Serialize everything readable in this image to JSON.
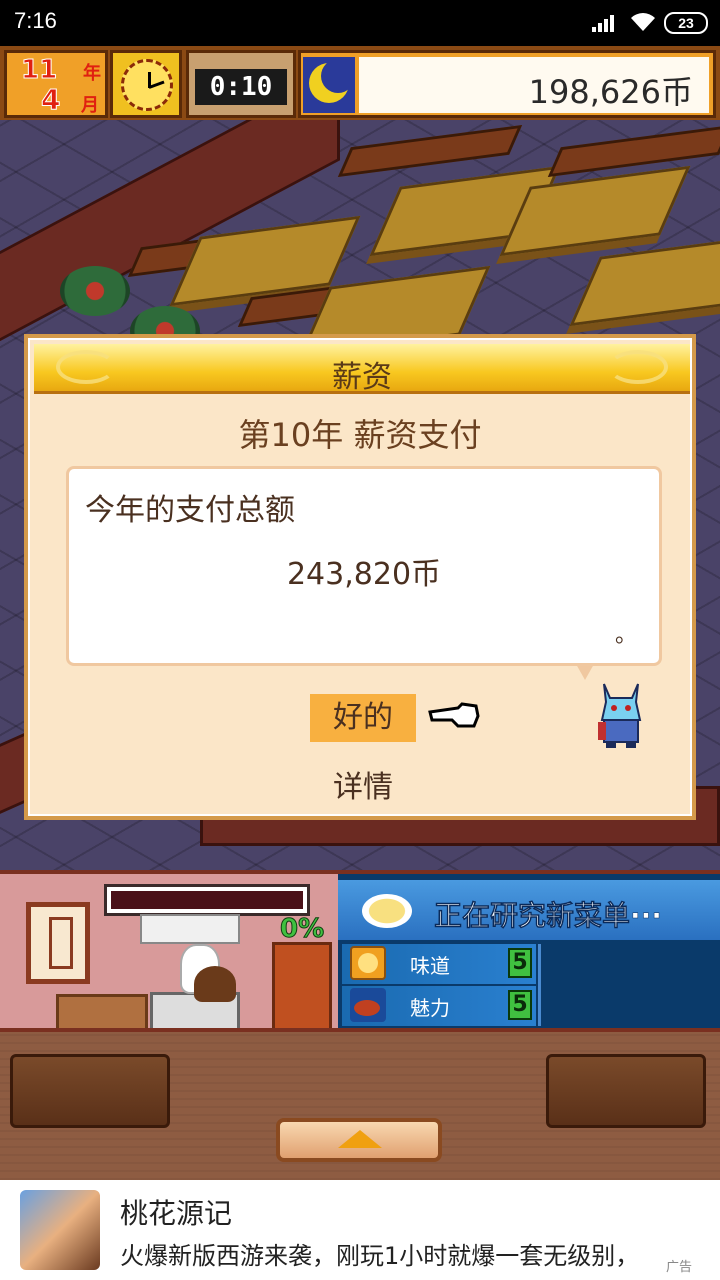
{
  "status_bar": {
    "time": "7:16",
    "battery": "23"
  },
  "hud": {
    "year_number": "11",
    "year_unit": "年",
    "month_number": "4",
    "month_unit": "月",
    "time": "0:10",
    "money": "198,626币",
    "icons": [
      "clock-icon",
      "moon-icon"
    ]
  },
  "dialog": {
    "title": "薪资",
    "subtitle": "第10年 薪资支付",
    "box_label": "今年的支付总额",
    "amount": "243,820币",
    "box_end": "。",
    "ok_button": "好的",
    "detail_button": "详情"
  },
  "kitchen": {
    "progress_percent": "0%",
    "progress_value": 0
  },
  "research": {
    "title": "正在研究新菜单···",
    "stats": [
      {
        "label": "味道",
        "value": "5",
        "icon": "taste-icon"
      },
      {
        "label": "魅力",
        "value": "5",
        "icon": "charm-icon"
      }
    ]
  },
  "ad": {
    "title": "桃花源记",
    "description": "火爆新版西游来袭，刚玩1小时就爆一套无级别，",
    "tag": "广告"
  },
  "colors": {
    "accent": "#f8b040",
    "dialog_bg": "#fbe6c8",
    "research_bg": "#0a3a6a"
  }
}
